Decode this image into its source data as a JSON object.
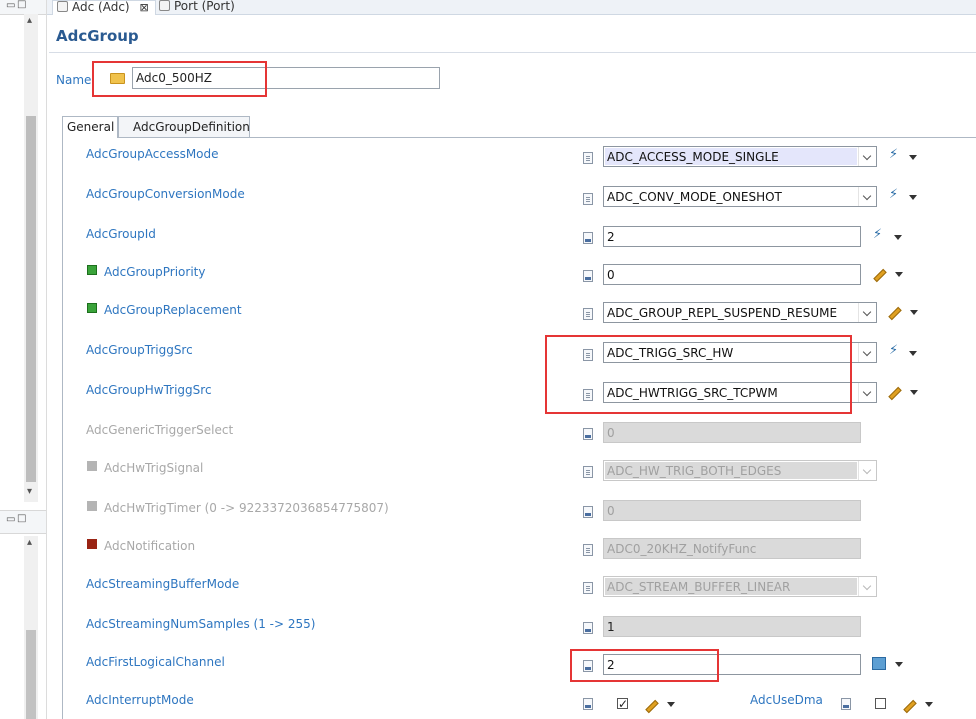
{
  "editor_tabs": [
    {
      "label": "Adc (Adc)",
      "close": "⊠",
      "active": true
    },
    {
      "label": "Port (Port)",
      "active": false
    }
  ],
  "page_title": "AdcGroup",
  "name_field": {
    "label": "Name",
    "value": "Adc0_500HZ"
  },
  "inner_tabs": [
    {
      "label": "General",
      "active": true
    },
    {
      "label": "AdcGroupDefinition",
      "active": false
    }
  ],
  "left_panel": {
    "min_icon": "▭",
    "restore_icon": "□",
    "down_arrow": "▾",
    "up_arrow": "▴"
  },
  "rows": [
    {
      "label": "AdcGroupAccessMode",
      "value": "ADC_ACCESS_MODE_SINGLE",
      "type": "dropdown",
      "enabled": true
    },
    {
      "label": "AdcGroupConversionMode",
      "value": "ADC_CONV_MODE_ONESHOT",
      "type": "dropdown",
      "enabled": true
    },
    {
      "label": "AdcGroupId",
      "value": "2",
      "type": "text",
      "enabled": true
    },
    {
      "label": "AdcGroupPriority",
      "value": "0",
      "type": "text",
      "enabled": true
    },
    {
      "label": "AdcGroupReplacement",
      "value": "ADC_GROUP_REPL_SUSPEND_RESUME",
      "type": "dropdown",
      "enabled": true
    },
    {
      "label": "AdcGroupTriggSrc",
      "value": "ADC_TRIGG_SRC_HW",
      "type": "dropdown",
      "enabled": true
    },
    {
      "label": "AdcGroupHwTriggSrc",
      "value": "ADC_HWTRIGG_SRC_TCPWM",
      "type": "dropdown",
      "enabled": true
    },
    {
      "label": "AdcGenericTriggerSelect",
      "value": "0",
      "type": "text",
      "enabled": false
    },
    {
      "label": "AdcHwTrigSignal",
      "value": "ADC_HW_TRIG_BOTH_EDGES",
      "type": "dropdown",
      "enabled": false
    },
    {
      "label": "AdcHwTrigTimer (0 -> 9223372036854775807)",
      "value": "0",
      "type": "text",
      "enabled": false
    },
    {
      "label": "AdcNotification",
      "value": "ADC0_20KHZ_NotifyFunc",
      "type": "text",
      "enabled": false
    },
    {
      "label": "AdcStreamingBufferMode",
      "value": "ADC_STREAM_BUFFER_LINEAR",
      "type": "dropdown",
      "enabled": false
    },
    {
      "label": "AdcStreamingNumSamples (1 -> 255)",
      "value": "1",
      "type": "text",
      "enabled": false
    },
    {
      "label": "AdcFirstLogicalChannel",
      "value": "2",
      "type": "text",
      "enabled": true
    },
    {
      "label": "AdcInterruptMode",
      "type": "checkbox",
      "checked": true,
      "enabled": true
    }
  ],
  "extra_field": {
    "label": "AdcUseDma",
    "checked": false
  },
  "check_glyph": "✓",
  "colors": {
    "label_blue": "#2e76c0",
    "title_blue": "#2a5a91",
    "highlight_red": "#e53535",
    "disabled_gray": "#dadada"
  }
}
